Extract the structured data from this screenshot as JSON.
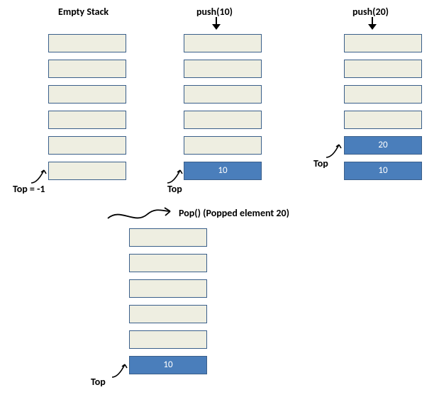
{
  "stacks": {
    "empty": {
      "title": "Empty Stack",
      "top_label": "Top = -1",
      "cells": [
        "",
        "",
        "",
        "",
        "",
        ""
      ]
    },
    "push10": {
      "title": "push(10)",
      "top_label": "Top",
      "cells": [
        "",
        "",
        "",
        "",
        "",
        "10"
      ]
    },
    "push20": {
      "title": "push(20)",
      "top_label": "Top",
      "cells": [
        "",
        "",
        "",
        "",
        "20",
        "10"
      ]
    },
    "pop": {
      "title": "Pop() (Popped element 20)",
      "top_label": "Top",
      "cells": [
        "",
        "",
        "",
        "",
        "",
        "10"
      ]
    }
  }
}
